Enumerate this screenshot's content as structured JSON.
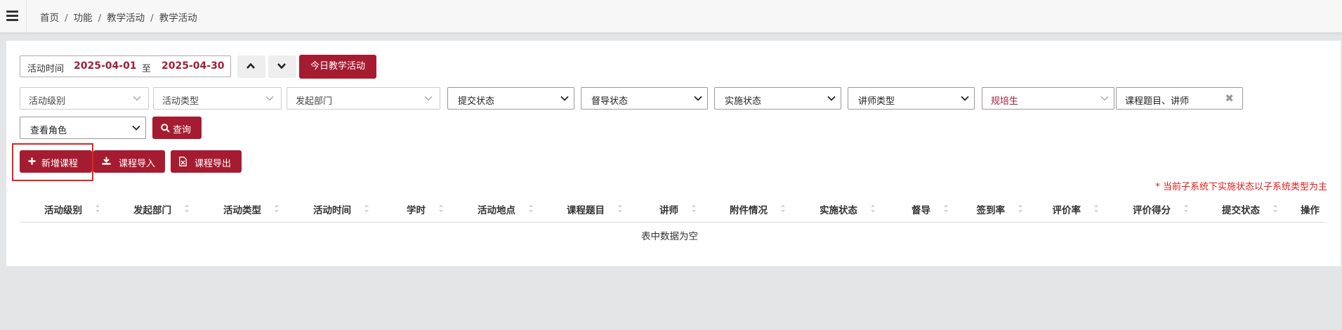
{
  "breadcrumb": [
    "首页",
    "功能",
    "教学活动",
    "教学活动"
  ],
  "date_range": {
    "label": "活动时间",
    "start": "2025-04-01",
    "to": "至",
    "end": "2025-04-30"
  },
  "buttons": {
    "today": "今日教学活动",
    "search": "查询",
    "add": "新增课程",
    "import": "课程导入",
    "export": "课程导出"
  },
  "filters": {
    "level": "活动级别",
    "type": "活动类型",
    "dept": "发起部门",
    "submit_status": "提交状态",
    "supervise_status": "督导状态",
    "impl_status": "实施状态",
    "lecturer_type": "讲师类型",
    "trainee": "规培生",
    "keyword": "课程题目、讲师",
    "role": "查看角色"
  },
  "note": "* 当前子系统下实施状态以子系统类型为主",
  "table": {
    "columns": [
      "活动级别",
      "发起部门",
      "活动类型",
      "活动时间",
      "学时",
      "活动地点",
      "课程题目",
      "讲师",
      "附件情况",
      "实施状态",
      "督导",
      "签到率",
      "评价率",
      "评价得分",
      "提交状态",
      "操作"
    ],
    "empty_text": "表中数据为空"
  },
  "colors": {
    "primary": "#a51c31",
    "note_red": "#e01c1c",
    "highlight": "#e02424"
  }
}
